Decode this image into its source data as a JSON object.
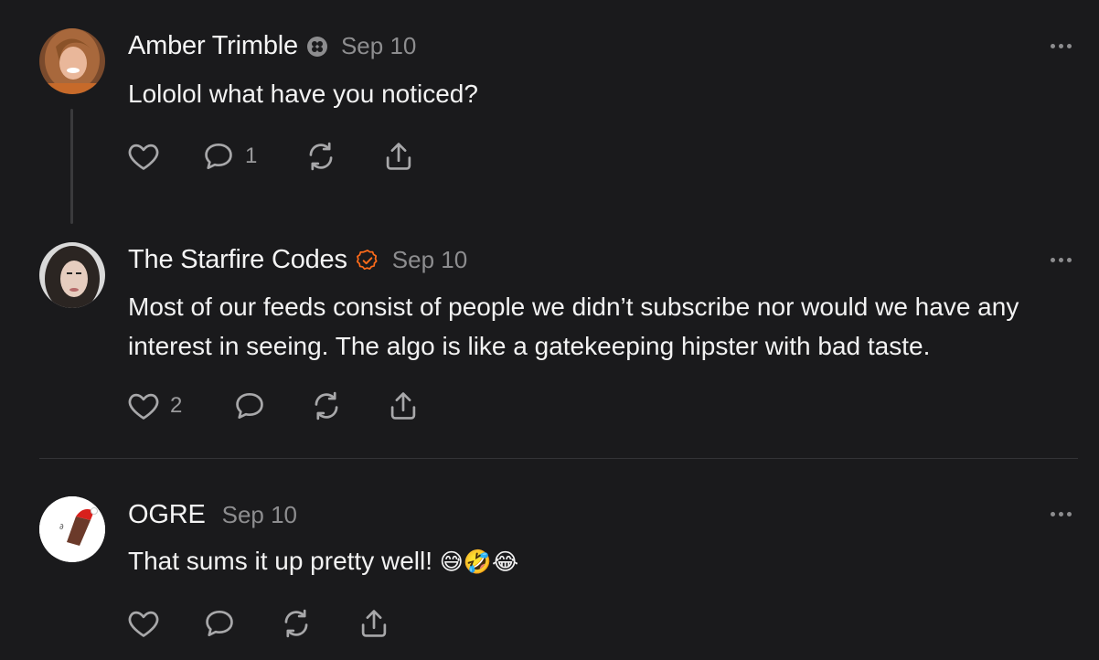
{
  "posts": [
    {
      "author": "Amber Trimble",
      "badge": "subscriber-badge-icon",
      "date": "Sep 10",
      "text": "Lololol what have you noticed?",
      "actions": {
        "likes": "",
        "comments": "1",
        "restacks": "",
        "share": ""
      }
    },
    {
      "author": "The Starfire Codes",
      "badge": "verified-check-icon",
      "date": "Sep 10",
      "text": "Most of our feeds consist of people we didn’t subscribe nor would we have any interest in seeing. The algo is like a gatekeeping hipster with bad taste.",
      "actions": {
        "likes": "2",
        "comments": "",
        "restacks": "",
        "share": ""
      }
    },
    {
      "author": "OGRE",
      "date": "Sep 10",
      "text": "That sums it up pretty well!",
      "emoji": "😅🤣😂",
      "actions": {
        "likes": "",
        "comments": "",
        "restacks": "",
        "share": ""
      }
    }
  ],
  "colors": {
    "background": "#1a1a1c",
    "text": "#f2f2f2",
    "muted": "#8d8d8f",
    "verified": "#ff6b1a"
  }
}
